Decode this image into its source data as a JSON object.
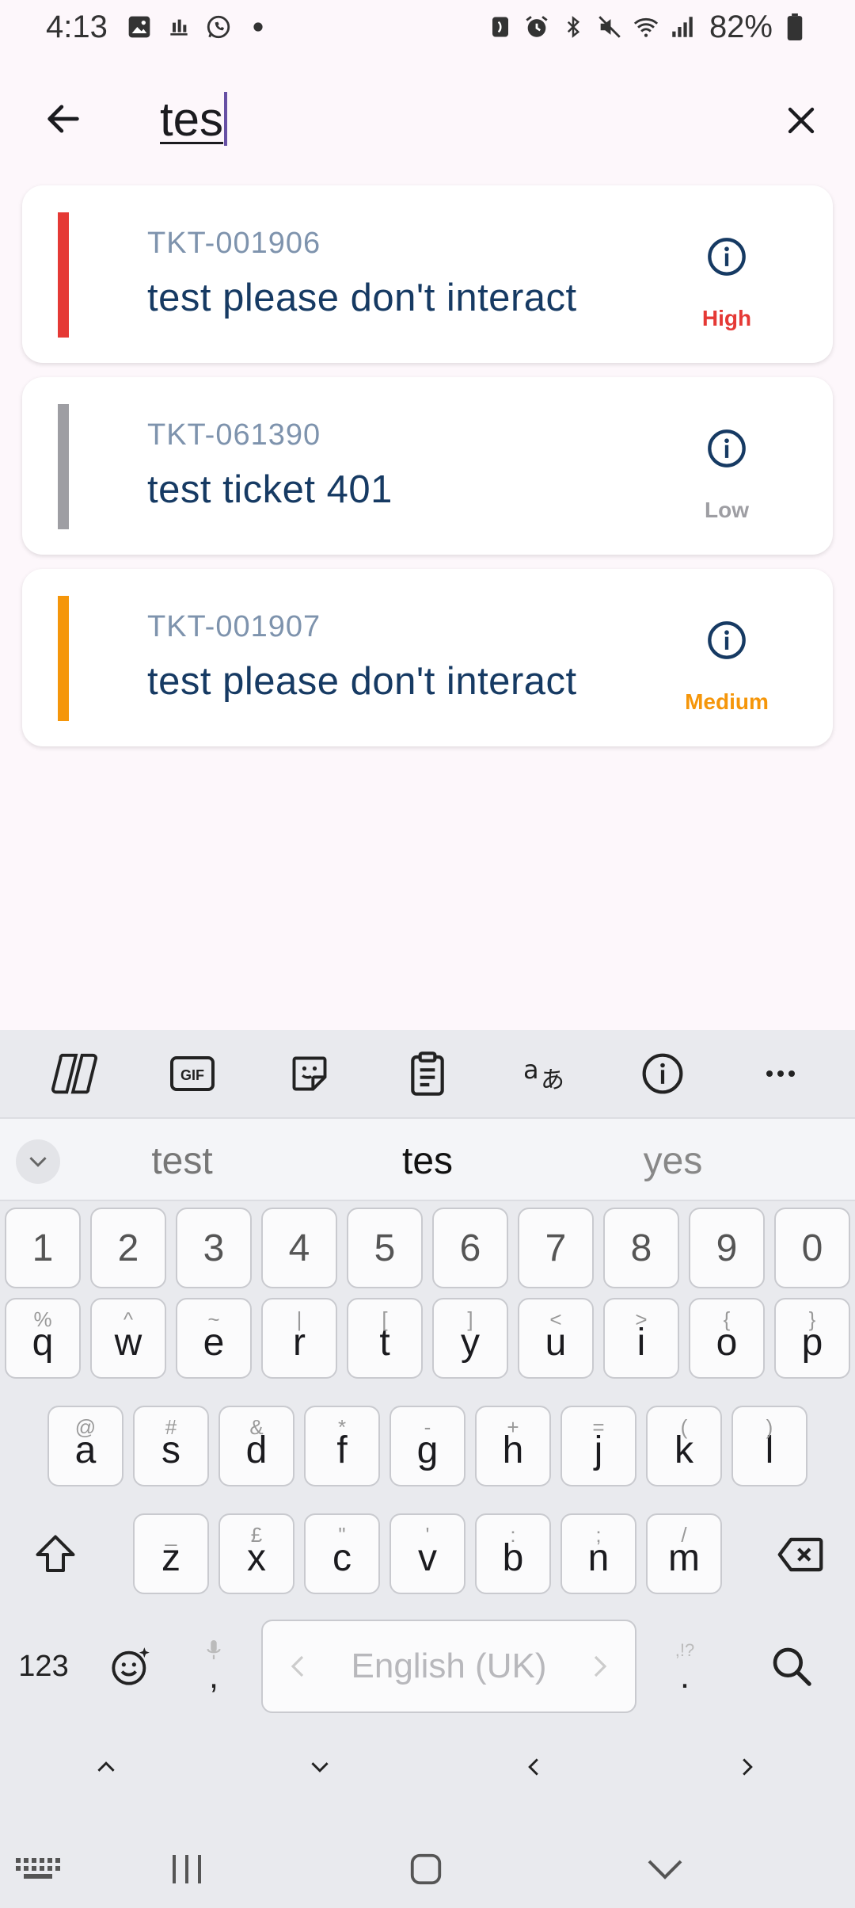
{
  "status_bar": {
    "time": "4:13",
    "battery": "82%"
  },
  "search": {
    "query": "tes"
  },
  "results": [
    {
      "id": "TKT-001906",
      "title": "test please don't interact",
      "priority": "High",
      "color": "#e53935"
    },
    {
      "id": "TKT-061390",
      "title": "test ticket 401",
      "priority": "Low",
      "color": "#9e9ea3"
    },
    {
      "id": "TKT-001907",
      "title": "test please don't interact",
      "priority": "Medium",
      "color": "#f5960a"
    }
  ],
  "keyboard": {
    "suggestions": [
      "test",
      "tes",
      "yes"
    ],
    "numbers": [
      "1",
      "2",
      "3",
      "4",
      "5",
      "6",
      "7",
      "8",
      "9",
      "0"
    ],
    "row1": [
      [
        "q",
        "%"
      ],
      [
        "w",
        "^"
      ],
      [
        "e",
        "~"
      ],
      [
        "r",
        "|"
      ],
      [
        "t",
        "["
      ],
      [
        "y",
        "]"
      ],
      [
        "u",
        "<"
      ],
      [
        "i",
        ">"
      ],
      [
        "o",
        "{"
      ],
      [
        "p",
        "}"
      ]
    ],
    "row2": [
      [
        "a",
        "@"
      ],
      [
        "s",
        "#"
      ],
      [
        "d",
        "&"
      ],
      [
        "f",
        "*"
      ],
      [
        "g",
        "-"
      ],
      [
        "h",
        "+"
      ],
      [
        "j",
        "="
      ],
      [
        "k",
        "("
      ],
      [
        "l",
        ")"
      ]
    ],
    "row3": [
      [
        "z",
        "_"
      ],
      [
        "x",
        "£"
      ],
      [
        "c",
        "\""
      ],
      [
        "v",
        "'"
      ],
      [
        "b",
        ":"
      ],
      [
        "n",
        ";"
      ],
      [
        "m",
        "/"
      ]
    ],
    "numbers_key": "123",
    "comma": ",",
    "period": ".",
    "period_hint": ",!?",
    "space_label": "English (UK)"
  }
}
